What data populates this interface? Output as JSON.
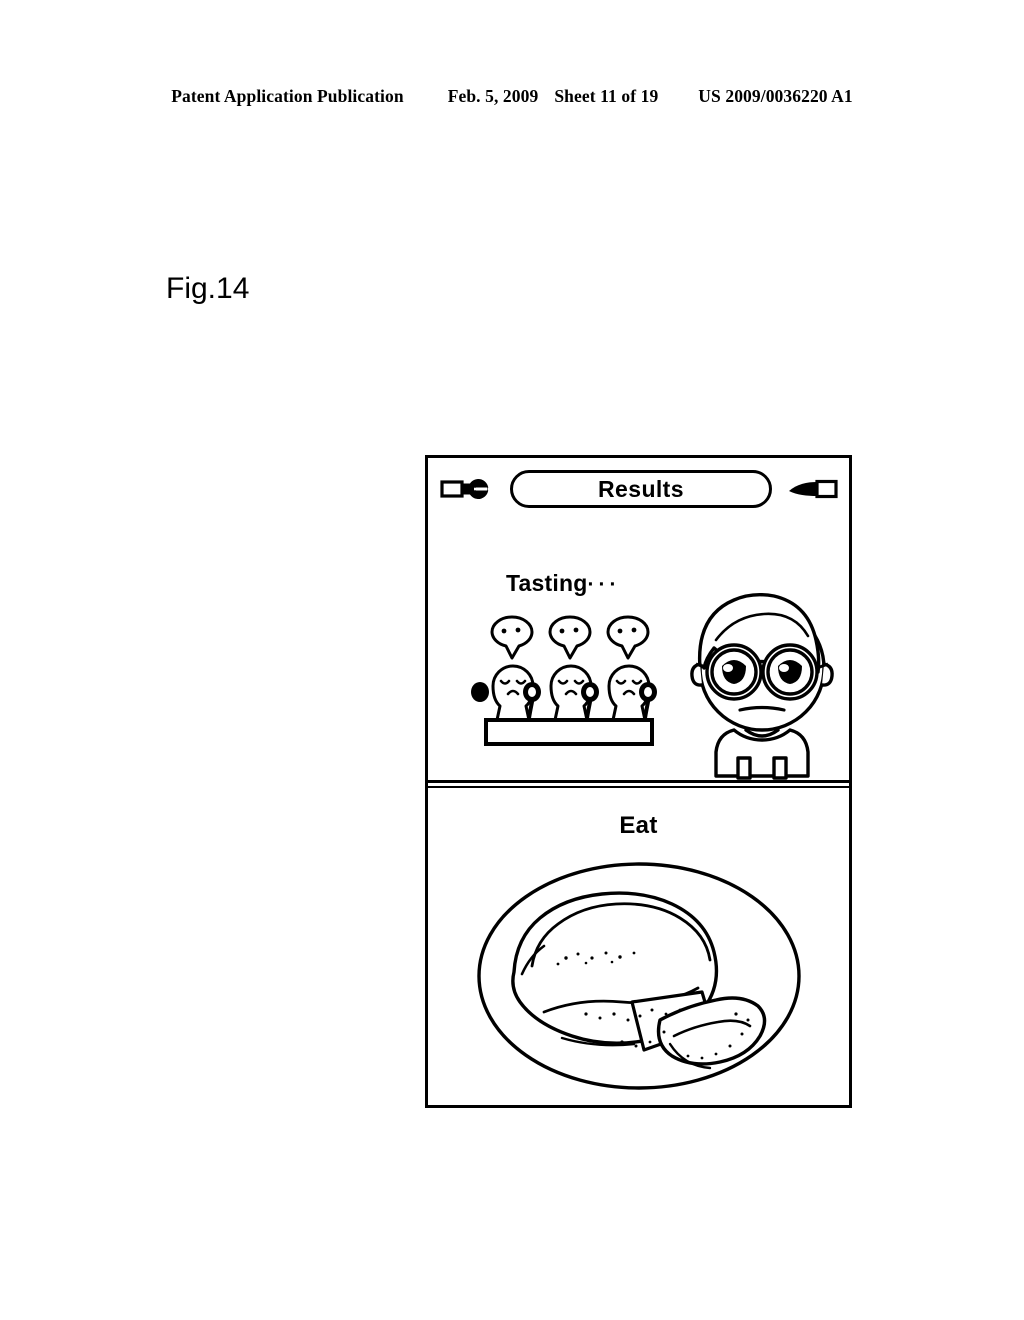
{
  "page": {
    "header": {
      "publication": "Patent Application Publication",
      "date": "Feb. 5, 2009",
      "sheet": "Sheet 11 of 19",
      "docnum": "US 2009/0036220 A1"
    },
    "figure_label": "Fig.14"
  },
  "device": {
    "top_screen": {
      "toolbar": {
        "left_icon": "fork-icon",
        "title": "Results",
        "right_icon": "knife-icon"
      },
      "status_text": "Tasting",
      "status_ellipsis": "···",
      "judges": [
        {
          "expression": "sad",
          "bubble": "eating-dots",
          "holding": "spoon-icon"
        },
        {
          "expression": "sad",
          "bubble": "eating-dots",
          "holding": "spoon-icon"
        },
        {
          "expression": "sad",
          "bubble": "eating-dots",
          "holding": "spoon-icon"
        }
      ],
      "judge_table": "counter-table",
      "player_character": {
        "name": "chef-avatar",
        "accessory": "round-glasses",
        "expression": "worried"
      }
    },
    "bottom_screen": {
      "action_label": "Eat",
      "dish": {
        "name": "pie-on-plate",
        "plate": "oval-plate",
        "item": "round-pie",
        "slice_state": "one-slice-cut"
      }
    }
  },
  "colors": {
    "ink": "#000000",
    "paper": "#ffffff"
  }
}
